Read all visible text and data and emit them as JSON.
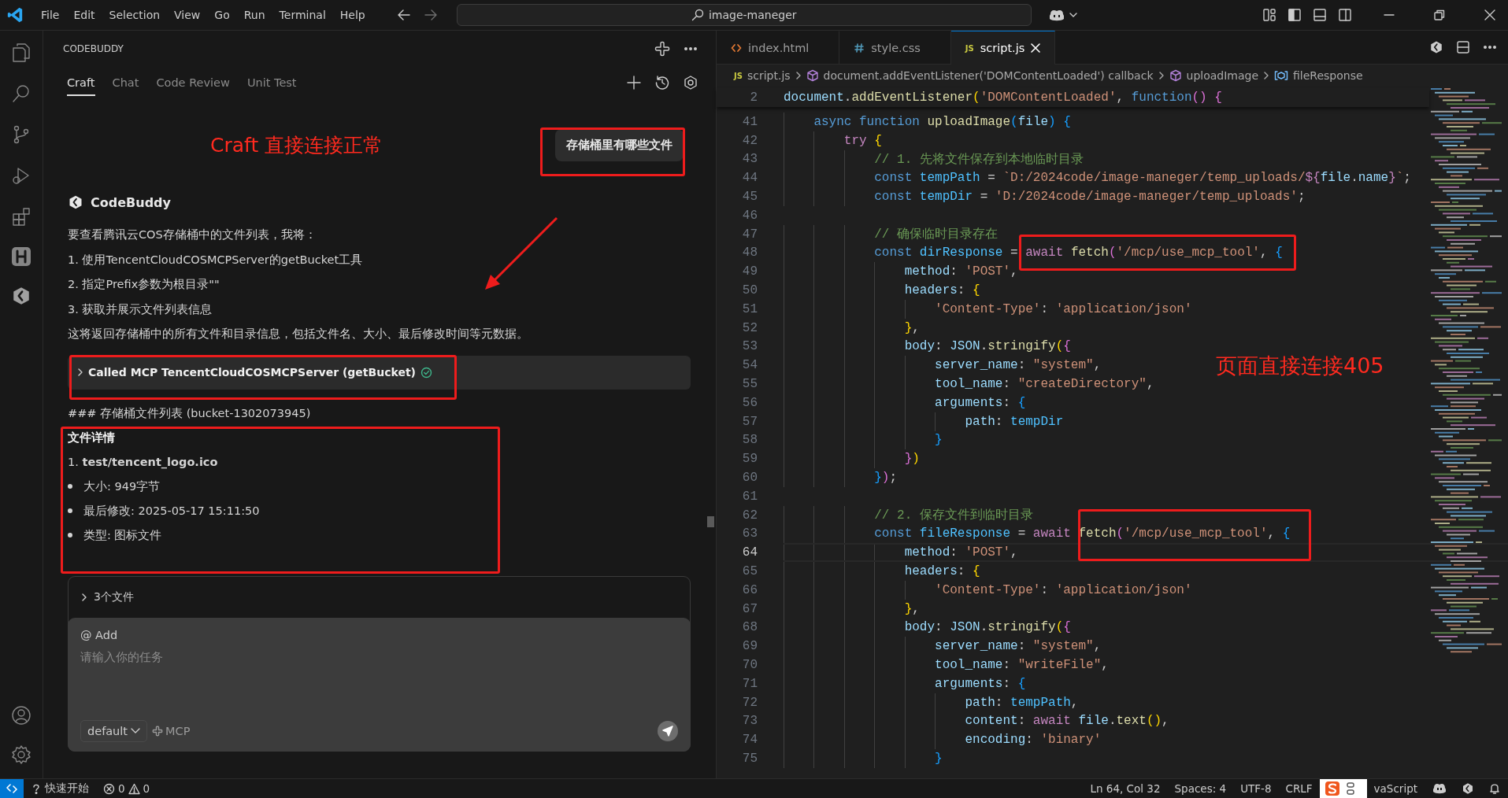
{
  "title_bar": {
    "menu": [
      "File",
      "Edit",
      "Selection",
      "View",
      "Go",
      "Run",
      "Terminal",
      "Help"
    ],
    "search": {
      "value": "image-maneger"
    }
  },
  "sidebar": {
    "title": "CODEBUDDY",
    "tabs": [
      {
        "label": "Craft",
        "selected": true
      },
      {
        "label": "Chat",
        "selected": false
      },
      {
        "label": "Code Review",
        "selected": false
      },
      {
        "label": "Unit Test",
        "selected": false
      }
    ],
    "annotation": "Craft 直接连接正常",
    "user_message": "存储桶里有哪些文件",
    "assistant_name": "CodeBuddy",
    "paragraphs": [
      "要查看腾讯云COS存储桶中的文件列表，我将：",
      "1. 使用TencentCloudCOSMCPServer的getBucket工具",
      "2. 指定Prefix参数为根目录\"\"",
      "3. 获取并展示文件列表信息",
      "这将返回存储桶中的所有文件和目录信息，包括文件名、大小、最后修改时间等元数据。"
    ],
    "tool_call": {
      "label": "Called MCP TencentCloudCOSMCPServer (getBucket)",
      "completed": true
    },
    "heading": "### 存储桶文件列表 (bucket-1302073945)",
    "details_title": "文件详情",
    "file": "1. **test/tencent_logo.ico**",
    "bullets": [
      "大小: 949字节",
      "最后修改: 2025-05-17 15:11:50",
      "类型: 图标文件"
    ],
    "files_summary": "3个文件",
    "composer": {
      "add": "@ Add",
      "placeholder": "请输入你的任务",
      "mode": "default",
      "mcp": "MCP"
    }
  },
  "editor": {
    "tabs": [
      {
        "label": "index.html",
        "kind": "html",
        "selected": false
      },
      {
        "label": "style.css",
        "kind": "css",
        "selected": false
      },
      {
        "label": "script.js",
        "kind": "js",
        "badge": "JS",
        "selected": true
      }
    ],
    "breadcrumb": [
      {
        "label": "script.js",
        "kind": "js",
        "badge": "JS"
      },
      {
        "label": "document.addEventListener('DOMContentLoaded') callback",
        "kind": "function"
      },
      {
        "label": "uploadImage",
        "kind": "function"
      },
      {
        "label": "fileResponse",
        "kind": "variable"
      }
    ],
    "annotation": "页面直接连接405",
    "sticky": {
      "number": "2",
      "tokens": [
        {
          "text": "document",
          "kind": "v"
        },
        {
          "text": ".",
          "kind": "p"
        },
        {
          "text": "addEventListener",
          "kind": "f"
        },
        {
          "text": "(",
          "kind": "b1"
        },
        {
          "text": "'DOMContentLoaded'",
          "kind": "s"
        },
        {
          "text": ", ",
          "kind": "p"
        },
        {
          "text": "function",
          "kind": "k"
        },
        {
          "text": "() {",
          "kind": "b2"
        }
      ]
    },
    "lines": [
      {
        "number": "41",
        "current": false,
        "tokens": [
          {
            "text": "    async function ",
            "kind": "k"
          },
          {
            "text": "uploadImage",
            "kind": "f"
          },
          {
            "text": "(",
            "kind": "b3"
          },
          {
            "text": "file",
            "kind": "v"
          },
          {
            "text": ") {",
            "kind": "b3"
          }
        ]
      },
      {
        "number": "42",
        "current": false,
        "tokens": [
          {
            "text": "        try ",
            "kind": "c"
          },
          {
            "text": "{",
            "kind": "b1"
          }
        ]
      },
      {
        "number": "43",
        "current": false,
        "tokens": [
          {
            "text": "            // 1. 先将文件保存到本地临时目录",
            "kind": "m"
          }
        ]
      },
      {
        "number": "44",
        "current": false,
        "tokens": [
          {
            "text": "            const ",
            "kind": "k"
          },
          {
            "text": "tempPath",
            "kind": "cv"
          },
          {
            "text": " = ",
            "kind": "p"
          },
          {
            "text": "`D:/2024code/image-maneger/temp_uploads/",
            "kind": "s"
          },
          {
            "text": "${",
            "kind": "c"
          },
          {
            "text": "file",
            "kind": "v"
          },
          {
            "text": ".",
            "kind": "p"
          },
          {
            "text": "name",
            "kind": "v"
          },
          {
            "text": "}",
            "kind": "c"
          },
          {
            "text": "`",
            "kind": "s"
          },
          {
            "text": ";",
            "kind": "p"
          }
        ]
      },
      {
        "number": "45",
        "current": false,
        "tokens": [
          {
            "text": "            const ",
            "kind": "k"
          },
          {
            "text": "tempDir",
            "kind": "cv"
          },
          {
            "text": " = ",
            "kind": "p"
          },
          {
            "text": "'D:/2024code/image-maneger/temp_uploads'",
            "kind": "s"
          },
          {
            "text": ";",
            "kind": "p"
          }
        ]
      },
      {
        "number": "46",
        "current": false
      },
      {
        "number": "47",
        "current": false,
        "tokens": [
          {
            "text": "            // 确保临时目录存在",
            "kind": "m"
          }
        ]
      },
      {
        "number": "48",
        "current": false,
        "tokens": [
          {
            "text": "            const ",
            "kind": "k"
          },
          {
            "text": "dirResponse",
            "kind": "cv"
          },
          {
            "text": " = ",
            "kind": "p"
          },
          {
            "text": "await ",
            "kind": "c"
          },
          {
            "text": "fetch",
            "kind": "f"
          },
          {
            "text": "(",
            "kind": "b2"
          },
          {
            "text": "'/mcp/use_mcp_tool'",
            "kind": "s"
          },
          {
            "text": ", ",
            "kind": "p"
          },
          {
            "text": "{",
            "kind": "b3"
          }
        ]
      },
      {
        "number": "49",
        "current": false,
        "tokens": [
          {
            "text": "                method",
            "kind": "v"
          },
          {
            "text": ": ",
            "kind": "p"
          },
          {
            "text": "'POST'",
            "kind": "s"
          },
          {
            "text": ",",
            "kind": "p"
          }
        ]
      },
      {
        "number": "50",
        "current": false,
        "tokens": [
          {
            "text": "                headers",
            "kind": "v"
          },
          {
            "text": ": ",
            "kind": "p"
          },
          {
            "text": "{",
            "kind": "b1"
          }
        ]
      },
      {
        "number": "51",
        "current": false,
        "tokens": [
          {
            "text": "                    'Content-Type'",
            "kind": "s"
          },
          {
            "text": ": ",
            "kind": "p"
          },
          {
            "text": "'application/json'",
            "kind": "s"
          }
        ]
      },
      {
        "number": "52",
        "current": false,
        "tokens": [
          {
            "text": "                }",
            "kind": "b1"
          },
          {
            "text": ",",
            "kind": "p"
          }
        ]
      },
      {
        "number": "53",
        "current": false,
        "tokens": [
          {
            "text": "                body",
            "kind": "v"
          },
          {
            "text": ": ",
            "kind": "p"
          },
          {
            "text": "JSON",
            "kind": "v"
          },
          {
            "text": ".",
            "kind": "p"
          },
          {
            "text": "stringify",
            "kind": "f"
          },
          {
            "text": "(",
            "kind": "b1"
          },
          {
            "text": "{",
            "kind": "b2"
          }
        ]
      },
      {
        "number": "54",
        "current": false,
        "tokens": [
          {
            "text": "                    server_name",
            "kind": "v"
          },
          {
            "text": ": ",
            "kind": "p"
          },
          {
            "text": "\"system\"",
            "kind": "s"
          },
          {
            "text": ",",
            "kind": "p"
          }
        ]
      },
      {
        "number": "55",
        "current": false,
        "tokens": [
          {
            "text": "                    tool_name",
            "kind": "v"
          },
          {
            "text": ": ",
            "kind": "p"
          },
          {
            "text": "\"createDirectory\"",
            "kind": "s"
          },
          {
            "text": ",",
            "kind": "p"
          }
        ]
      },
      {
        "number": "56",
        "current": false,
        "tokens": [
          {
            "text": "                    arguments",
            "kind": "v"
          },
          {
            "text": ": ",
            "kind": "p"
          },
          {
            "text": "{",
            "kind": "b3"
          }
        ]
      },
      {
        "number": "57",
        "current": false,
        "tokens": [
          {
            "text": "                        path",
            "kind": "v"
          },
          {
            "text": ": ",
            "kind": "p"
          },
          {
            "text": "tempDir",
            "kind": "cv"
          }
        ]
      },
      {
        "number": "58",
        "current": false,
        "tokens": [
          {
            "text": "                    }",
            "kind": "b3"
          }
        ]
      },
      {
        "number": "59",
        "current": false,
        "tokens": [
          {
            "text": "                }",
            "kind": "b2"
          },
          {
            "text": ")",
            "kind": "b1"
          }
        ]
      },
      {
        "number": "60",
        "current": false,
        "tokens": [
          {
            "text": "            }",
            "kind": "b3"
          },
          {
            "text": ")",
            "kind": "b2"
          },
          {
            "text": ";",
            "kind": "p"
          }
        ]
      },
      {
        "number": "61",
        "current": false
      },
      {
        "number": "62",
        "current": false,
        "tokens": [
          {
            "text": "            // 2. 保存文件到临时目录",
            "kind": "m"
          }
        ]
      },
      {
        "number": "63",
        "current": false,
        "tokens": [
          {
            "text": "            const ",
            "kind": "k"
          },
          {
            "text": "fileResponse",
            "kind": "cv"
          },
          {
            "text": " = ",
            "kind": "p"
          },
          {
            "text": "await ",
            "kind": "c"
          },
          {
            "text": "fetch",
            "kind": "f"
          },
          {
            "text": "(",
            "kind": "b2"
          },
          {
            "text": "'/mcp/use_mcp_tool'",
            "kind": "s"
          },
          {
            "text": ", ",
            "kind": "p"
          },
          {
            "text": "{",
            "kind": "b3"
          }
        ]
      },
      {
        "number": "64",
        "current": true,
        "tokens": [
          {
            "text": "                method",
            "kind": "v"
          },
          {
            "text": ": ",
            "kind": "p"
          },
          {
            "text": "'POST'",
            "kind": "s"
          },
          {
            "text": ",",
            "kind": "p"
          }
        ]
      },
      {
        "number": "65",
        "current": false,
        "tokens": [
          {
            "text": "                headers",
            "kind": "v"
          },
          {
            "text": ": ",
            "kind": "p"
          },
          {
            "text": "{",
            "kind": "b1"
          }
        ]
      },
      {
        "number": "66",
        "current": false,
        "tokens": [
          {
            "text": "                    'Content-Type'",
            "kind": "s"
          },
          {
            "text": ": ",
            "kind": "p"
          },
          {
            "text": "'application/json'",
            "kind": "s"
          }
        ]
      },
      {
        "number": "67",
        "current": false,
        "tokens": [
          {
            "text": "                }",
            "kind": "b1"
          },
          {
            "text": ",",
            "kind": "p"
          }
        ]
      },
      {
        "number": "68",
        "current": false,
        "tokens": [
          {
            "text": "                body",
            "kind": "v"
          },
          {
            "text": ": ",
            "kind": "p"
          },
          {
            "text": "JSON",
            "kind": "v"
          },
          {
            "text": ".",
            "kind": "p"
          },
          {
            "text": "stringify",
            "kind": "f"
          },
          {
            "text": "(",
            "kind": "b1"
          },
          {
            "text": "{",
            "kind": "b2"
          }
        ]
      },
      {
        "number": "69",
        "current": false,
        "tokens": [
          {
            "text": "                    server_name",
            "kind": "v"
          },
          {
            "text": ": ",
            "kind": "p"
          },
          {
            "text": "\"system\"",
            "kind": "s"
          },
          {
            "text": ",",
            "kind": "p"
          }
        ]
      },
      {
        "number": "70",
        "current": false,
        "tokens": [
          {
            "text": "                    tool_name",
            "kind": "v"
          },
          {
            "text": ": ",
            "kind": "p"
          },
          {
            "text": "\"writeFile\"",
            "kind": "s"
          },
          {
            "text": ",",
            "kind": "p"
          }
        ]
      },
      {
        "number": "71",
        "current": false,
        "tokens": [
          {
            "text": "                    arguments",
            "kind": "v"
          },
          {
            "text": ": ",
            "kind": "p"
          },
          {
            "text": "{",
            "kind": "b3"
          }
        ]
      },
      {
        "number": "72",
        "current": false,
        "tokens": [
          {
            "text": "                        path",
            "kind": "v"
          },
          {
            "text": ": ",
            "kind": "p"
          },
          {
            "text": "tempPath",
            "kind": "cv"
          },
          {
            "text": ",",
            "kind": "p"
          }
        ]
      },
      {
        "number": "73",
        "current": false,
        "tokens": [
          {
            "text": "                        content",
            "kind": "v"
          },
          {
            "text": ": ",
            "kind": "p"
          },
          {
            "text": "await ",
            "kind": "c"
          },
          {
            "text": "file",
            "kind": "v"
          },
          {
            "text": ".",
            "kind": "p"
          },
          {
            "text": "text",
            "kind": "f"
          },
          {
            "text": "()",
            "kind": "b1"
          },
          {
            "text": ",",
            "kind": "p"
          }
        ]
      },
      {
        "number": "74",
        "current": false,
        "tokens": [
          {
            "text": "                        encoding",
            "kind": "v"
          },
          {
            "text": ": ",
            "kind": "p"
          },
          {
            "text": "'binary'",
            "kind": "s"
          }
        ]
      },
      {
        "number": "75",
        "current": false,
        "tokens": [
          {
            "text": "                    }",
            "kind": "b3"
          }
        ]
      }
    ]
  },
  "status_bar": {
    "quick_start": "快速开始",
    "errors": "0",
    "warnings": "0",
    "right": [
      "Ln 64, Col 32",
      "Spaces: 4",
      "UTF-8",
      "CRLF"
    ],
    "language": "vaScript"
  }
}
